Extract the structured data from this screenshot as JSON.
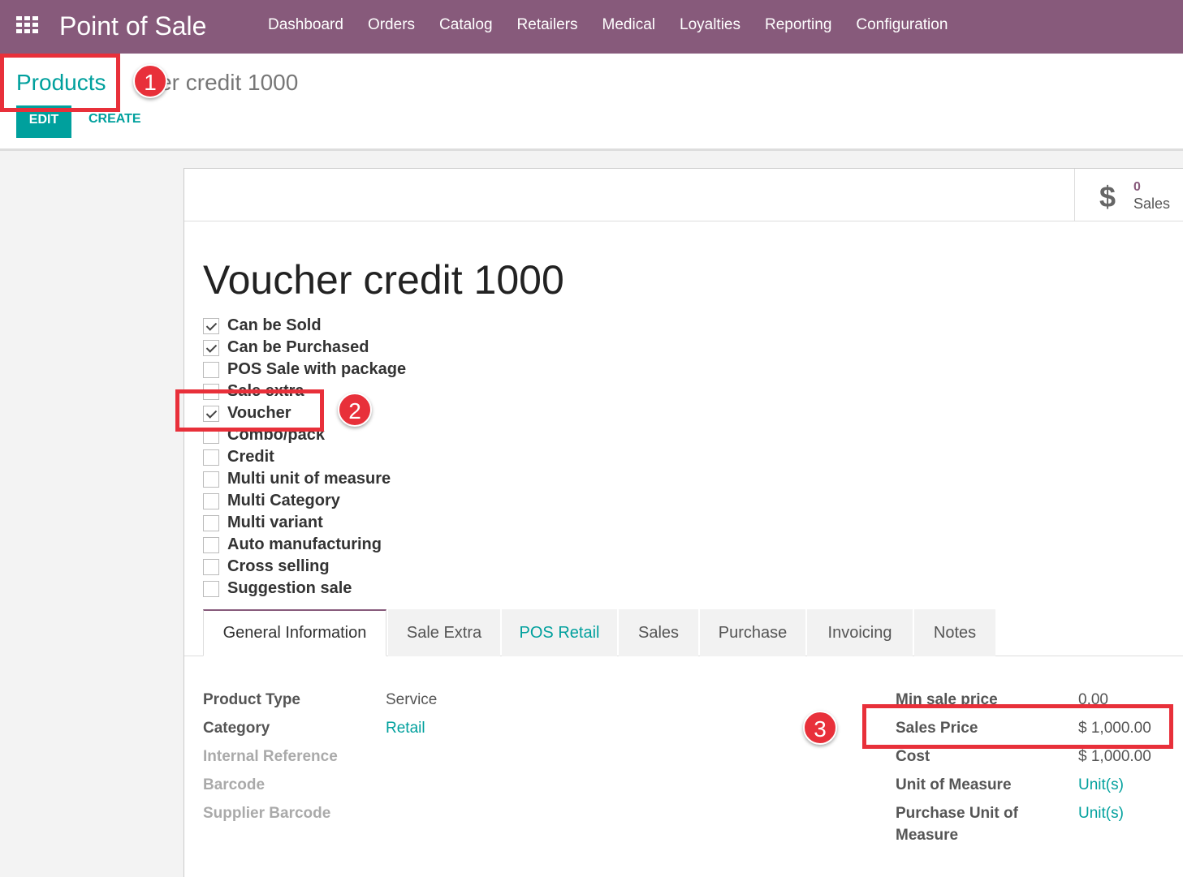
{
  "navbar": {
    "app_title": "Point of Sale",
    "menu": [
      "Dashboard",
      "Orders",
      "Catalog",
      "Retailers",
      "Medical",
      "Loyalties",
      "Reporting",
      "Configuration"
    ]
  },
  "breadcrumb": {
    "parent": "Products",
    "current": "Voucher credit 1000",
    "current_visible": "cher credit 1000"
  },
  "actions": {
    "edit": "EDIT",
    "create": "CREATE"
  },
  "stat": {
    "icon": "dollar-icon",
    "value": "0",
    "label": "Sales"
  },
  "product": {
    "name": "Voucher credit 1000"
  },
  "options": [
    {
      "label": "Can be Sold",
      "checked": true
    },
    {
      "label": "Can be Purchased",
      "checked": true
    },
    {
      "label": "POS Sale with package",
      "checked": false
    },
    {
      "label": "Sale extra",
      "checked": false
    },
    {
      "label": "Voucher",
      "checked": true
    },
    {
      "label": "Combo/pack",
      "checked": false
    },
    {
      "label": "Credit",
      "checked": false
    },
    {
      "label": "Multi unit of measure",
      "checked": false
    },
    {
      "label": "Multi Category",
      "checked": false
    },
    {
      "label": "Multi variant",
      "checked": false
    },
    {
      "label": "Auto manufacturing",
      "checked": false
    },
    {
      "label": "Cross selling",
      "checked": false
    },
    {
      "label": "Suggestion sale",
      "checked": false
    }
  ],
  "tabs": [
    "General Information",
    "Sale Extra",
    "POS Retail",
    "Sales",
    "Purchase",
    "Invoicing",
    "Notes"
  ],
  "general": {
    "product_type_label": "Product Type",
    "product_type": "Service",
    "category_label": "Category",
    "category": "Retail",
    "internal_reference_label": "Internal Reference",
    "barcode_label": "Barcode",
    "supplier_barcode_label": "Supplier Barcode",
    "min_sale_price_label": "Min sale price",
    "min_sale_price": "0.00",
    "sales_price_label": "Sales Price",
    "sales_price": "$ 1,000.00",
    "cost_label": "Cost",
    "cost": "$ 1,000.00",
    "uom_label": "Unit of Measure",
    "uom": "Unit(s)",
    "purchase_uom_label_1": "Purchase Unit of",
    "purchase_uom_label_2": "Measure",
    "purchase_uom": "Unit(s)"
  },
  "annotations": [
    "1",
    "2",
    "3"
  ],
  "colors": {
    "brand": "#875a7b",
    "accent": "#00a09d",
    "annotation": "#e8303a"
  }
}
